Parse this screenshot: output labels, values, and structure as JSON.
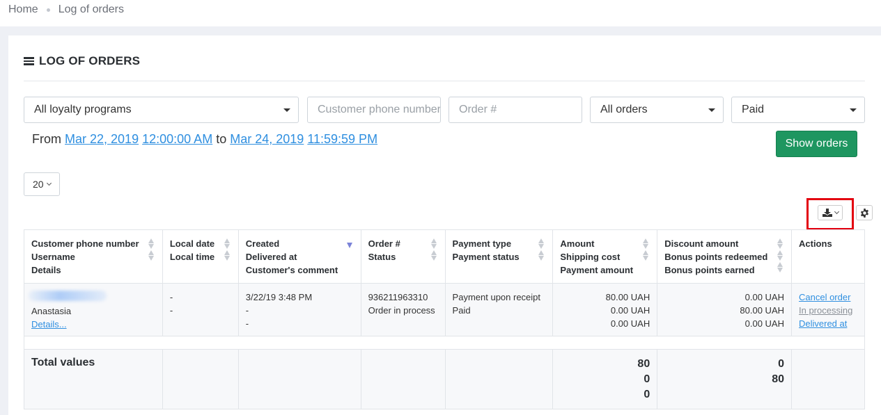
{
  "breadcrumb": {
    "home": "Home",
    "current": "Log of orders"
  },
  "page": {
    "title": "LOG OF ORDERS"
  },
  "filters": {
    "loyalty_program": "All loyalty programs",
    "phone_placeholder": "Customer phone number",
    "order_placeholder": "Order #",
    "order_type": "All orders",
    "payment_state": "Paid",
    "show_button": "Show orders"
  },
  "daterange": {
    "from_label": "From",
    "from_date": "Mar 22, 2019",
    "from_time": "12:00:00 AM",
    "to_label": "to",
    "to_date": "Mar 24, 2019",
    "to_time": "11:59:59 PM"
  },
  "pagination": {
    "page_size": "20"
  },
  "toolbar": {
    "export_icon": "download-icon",
    "settings_icon": "gear-icon"
  },
  "table": {
    "headers": [
      {
        "lines": [
          "Customer phone number",
          "Username",
          "Details"
        ]
      },
      {
        "lines": [
          "Local date",
          "Local time"
        ]
      },
      {
        "lines": [
          "Created",
          "Delivered at",
          "Customer's comment"
        ]
      },
      {
        "lines": [
          "Order #",
          "Status"
        ]
      },
      {
        "lines": [
          "Payment type",
          "Payment status"
        ]
      },
      {
        "lines": [
          "Amount",
          "Shipping cost",
          "Payment amount"
        ]
      },
      {
        "lines": [
          "Discount amount",
          "Bonus points redeemed",
          "Bonus points earned"
        ]
      },
      {
        "lines": [
          "Actions"
        ]
      }
    ],
    "row": {
      "username": "Anastasia",
      "details_link": "Details...",
      "local_date": "-",
      "local_time": "-",
      "created": "3/22/19 3:48 PM",
      "delivered": "-",
      "comment": "-",
      "order_no": "936211963310",
      "status": "Order in process",
      "payment_type": "Payment upon receipt",
      "payment_status": "Paid",
      "amount": "80.00 UAH",
      "shipping": "0.00 UAH",
      "payment_amount": "0.00 UAH",
      "discount": "0.00 UAH",
      "bonus_redeemed": "80.00 UAH",
      "bonus_earned": "0.00 UAH",
      "action_cancel": "Cancel order",
      "action_processing": "In processing",
      "action_delivered": "Delivered at"
    },
    "totals": {
      "label": "Total values",
      "amount": "80",
      "shipping": "0",
      "payment_amount": "0",
      "discount": "0",
      "bonus_redeemed": "80"
    }
  }
}
